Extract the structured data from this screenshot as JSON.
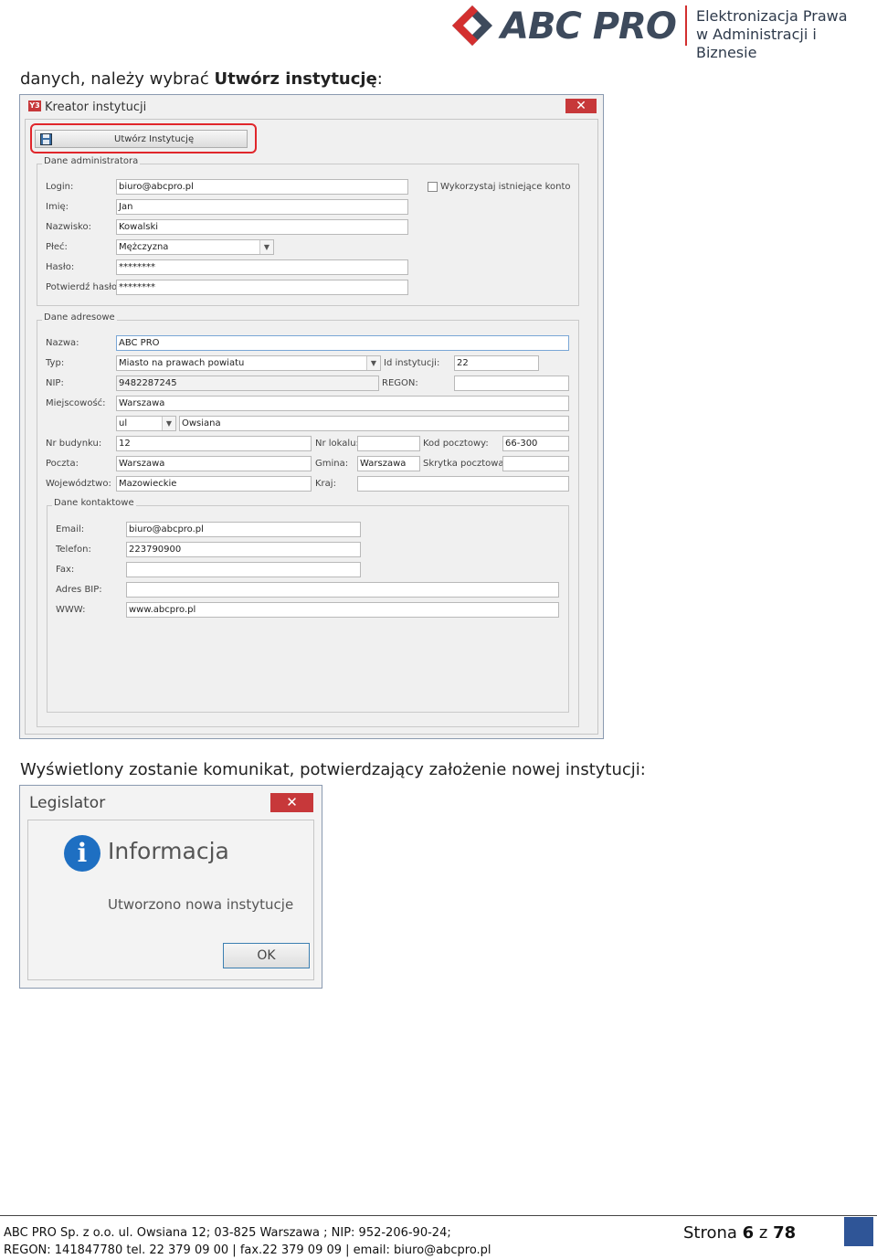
{
  "header": {
    "brand": "ABC PRO",
    "tagline_line1": "Elektronizacja Prawa",
    "tagline_line2": "w Administracji i Biznesie"
  },
  "intro": {
    "prefix": "danych, należy wybrać ",
    "bold": "Utwórz instytucję",
    "suffix": ":"
  },
  "wizard": {
    "title": "Kreator instytucji",
    "close": "✕",
    "create_button": "Utwórz Instytucję",
    "admin_group": "Dane administratora",
    "use_existing": "Wykorzystaj istniejące konto",
    "login_label": "Login:",
    "login_value": "biuro@abcpro.pl",
    "first_name_label": "Imię:",
    "first_name_value": "Jan",
    "last_name_label": "Nazwisko:",
    "last_name_value": "Kowalski",
    "gender_label": "Płeć:",
    "gender_value": "Mężczyzna",
    "password_label": "Hasło:",
    "password_value": "********",
    "confirm_label": "Potwierdź hasło:",
    "confirm_value": "********",
    "address_group": "Dane adresowe",
    "name_label": "Nazwa:",
    "name_value": "ABC PRO",
    "type_label": "Typ:",
    "type_value": "Miasto na prawach powiatu",
    "id_label": "Id instytucji:",
    "id_value": "22",
    "nip_label": "NIP:",
    "nip_value": "9482287245",
    "regon_label": "REGON:",
    "regon_value": "",
    "city_label": "Miejscowość:",
    "city_value": "Warszawa",
    "street_prefix": "ul",
    "street_value": "Owsiana",
    "building_label": "Nr budynku:",
    "building_value": "12",
    "local_label": "Nr lokalu:",
    "local_value": "",
    "postal_label": "Kod pocztowy:",
    "postal_value": "66-300",
    "post_label": "Poczta:",
    "post_value": "Warszawa",
    "commune_label": "Gmina:",
    "commune_value": "Warszawa",
    "pobox_label": "Skrytka pocztowa:",
    "pobox_value": "",
    "voivodeship_label": "Województwo:",
    "voivodeship_value": "Mazowieckie",
    "country_label": "Kraj:",
    "country_value": "",
    "contact_group": "Dane kontaktowe",
    "email_label": "Email:",
    "email_value": "biuro@abcpro.pl",
    "phone_label": "Telefon:",
    "phone_value": "223790900",
    "fax_label": "Fax:",
    "fax_value": "",
    "bip_label": "Adres BIP:",
    "bip_value": "",
    "www_label": "WWW:",
    "www_value": "www.abcpro.pl"
  },
  "mid_text": "Wyświetlony zostanie komunikat, potwierdzający założenie nowej instytucji:",
  "dialog": {
    "title": "Legislator",
    "close": "✕",
    "icon_letter": "i",
    "heading": "Informacja",
    "message": "Utworzono nowa instytucje",
    "ok": "OK"
  },
  "footer": {
    "line1": "ABC PRO Sp. z o.o. ul. Owsiana 12;  03-825 Warszawa ; NIP: 952-206-90-24;",
    "line2": "REGON: 141847780 tel. 22 379 09 00 | fax.22 379 09 09 | email: biuro@abcpro.pl",
    "page_prefix": "Strona ",
    "page_number": "6",
    "page_mid": " z ",
    "page_total": "78"
  },
  "colors": {
    "accent_red": "#e0262b",
    "brand_blue": "#2f5597",
    "info_blue": "#1e6fc2"
  }
}
